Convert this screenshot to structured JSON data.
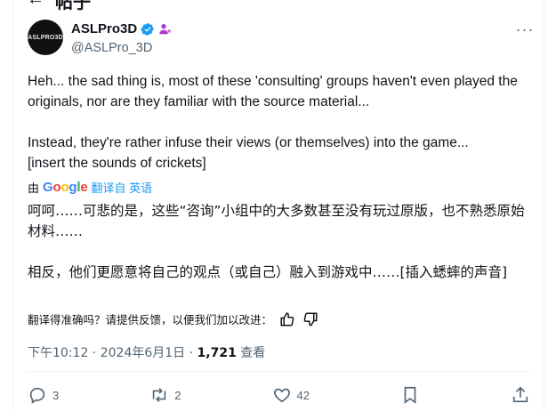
{
  "page": {
    "title_partial": "帖子"
  },
  "author": {
    "display_name": "ASLPro3D",
    "handle": "@ASLPro_3D",
    "avatar_text": "ASLPRO3D",
    "verified_color": "#1d9bf0"
  },
  "tweet": {
    "text": "Heh... the sad thing is, most of these 'consulting' groups haven't even played the originals, nor are they familiar with the source material...\n\nInstead, they're rather infuse their views (or themselves) into the game...\n[insert the sounds of crickets]"
  },
  "translation": {
    "by_label": "由",
    "provider": "Google",
    "link_label": "翻译自 英语",
    "text": "呵呵……可悲的是，这些“咨询”小组中的大多数甚至没有玩过原版，也不熟悉原始材料……\n\n相反，他们更愿意将自己的观点（或自己）融入到游戏中……[插入蟋蟀的声音]",
    "feedback_prompt": "翻译得准确吗？请提供反馈，以便我们加以改进："
  },
  "meta": {
    "time": "下午10:12",
    "date": "2024年6月1日",
    "separator": " · ",
    "views_count": "1,721",
    "views_label": "查看"
  },
  "actions": {
    "replies": "3",
    "reposts": "2",
    "likes": "42"
  },
  "icons": [
    "more-icon",
    "verified-icon",
    "affiliate-badge-icon",
    "thumbs-up-icon",
    "thumbs-down-icon",
    "reply-icon",
    "repost-icon",
    "like-icon",
    "bookmark-icon",
    "share-icon"
  ]
}
